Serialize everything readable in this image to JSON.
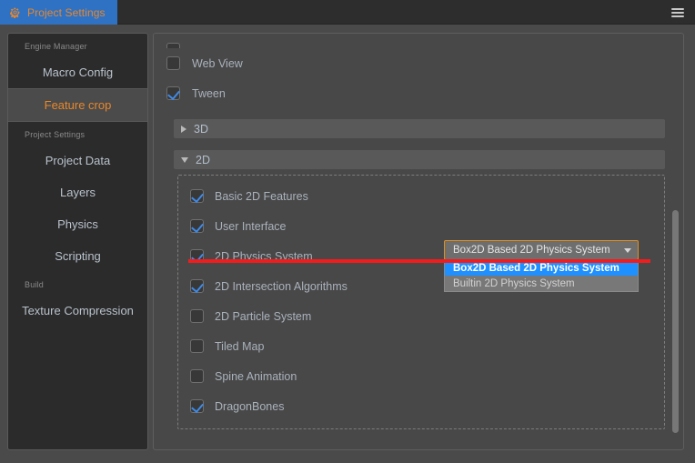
{
  "window": {
    "tab_label": "Project Settings",
    "tab_icon": "gear-icon",
    "menu_icon": "hamburger-icon",
    "accent_color": "#e8872a",
    "tab_active_color": "#2f72c4",
    "annotation_color": "#f31c1c",
    "dropdown_border_color": "#e09020",
    "highlight_color": "#1e90ff"
  },
  "sidebar": {
    "groups": [
      {
        "label": "Engine Manager",
        "items": [
          {
            "label": "Macro Config",
            "selected": false
          },
          {
            "label": "Feature crop",
            "selected": true
          }
        ]
      },
      {
        "label": "Project Settings",
        "items": [
          {
            "label": "Project Data",
            "selected": false
          },
          {
            "label": "Layers",
            "selected": false
          },
          {
            "label": "Physics",
            "selected": false
          },
          {
            "label": "Scripting",
            "selected": false
          }
        ]
      },
      {
        "label": "Build",
        "items": [
          {
            "label": "Texture Compression",
            "selected": false
          }
        ]
      }
    ]
  },
  "main": {
    "top_features": [
      {
        "label": "Web View",
        "checked": false
      },
      {
        "label": "Tween",
        "checked": true
      }
    ],
    "group_3d": {
      "title": "3D",
      "expanded": false,
      "arrow": "triangle-right-icon"
    },
    "group_2d": {
      "title": "2D",
      "expanded": true,
      "arrow": "triangle-down-icon",
      "features": [
        {
          "label": "Basic 2D Features",
          "checked": true
        },
        {
          "label": "User Interface",
          "checked": true
        },
        {
          "label": "2D Physics System",
          "checked": true,
          "has_dropdown": true
        },
        {
          "label": "2D Intersection Algorithms",
          "checked": true
        },
        {
          "label": "2D Particle System",
          "checked": false
        },
        {
          "label": "Tiled Map",
          "checked": false
        },
        {
          "label": "Spine Animation",
          "checked": false
        },
        {
          "label": "DragonBones",
          "checked": true
        }
      ]
    },
    "physics_dropdown": {
      "selected": "Box2D Based 2D Physics System",
      "open": true,
      "caret_icon": "chevron-down-icon",
      "options": [
        {
          "label": "Box2D Based 2D Physics System",
          "selected": true
        },
        {
          "label": "Builtin 2D Physics System",
          "selected": false
        }
      ]
    }
  }
}
